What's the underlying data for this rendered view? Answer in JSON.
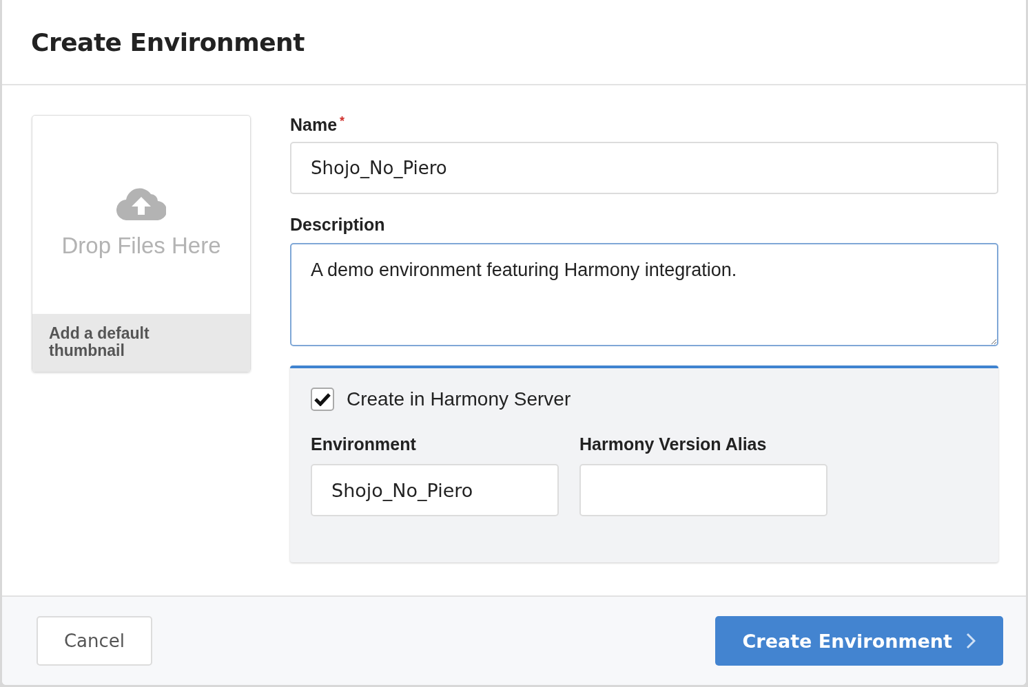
{
  "dialog": {
    "title": "Create Environment"
  },
  "thumbnail": {
    "drop_text": "Drop Files Here",
    "caption": "Add a default thumbnail"
  },
  "name_field": {
    "label": "Name",
    "required": true,
    "required_mark": "*",
    "value": "Shojo_No_Piero"
  },
  "description_field": {
    "label": "Description",
    "value": "A demo environment featuring Harmony integration.",
    "focused": true
  },
  "harmony_panel": {
    "checkbox": {
      "label": "Create in Harmony Server",
      "checked": true
    },
    "fields": [
      {
        "label": "Environment",
        "value": "Shojo_No_Piero"
      },
      {
        "label": "Harmony Version Alias"
      }
    ]
  },
  "buttons": {
    "cancel": "Cancel",
    "submit": "Create Environment"
  }
}
